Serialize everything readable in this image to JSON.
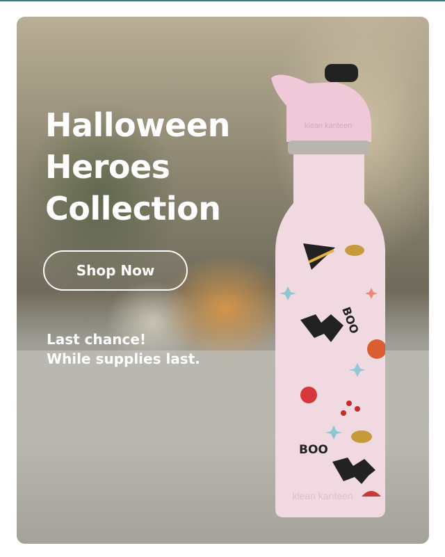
{
  "promo": {
    "headline": [
      "Halloween",
      "Heroes",
      "Collection"
    ],
    "cta_label": "Shop Now",
    "note": [
      "Last chance!",
      "While supplies last."
    ]
  },
  "product": {
    "brand_mark": "klean kanteen",
    "print_words": [
      "BOO",
      "BOO"
    ]
  },
  "colors": {
    "bottle_pink": "#f1d9e1",
    "cap_pink": "#efc9d8",
    "text": "#ffffff",
    "top_rule": "#2f7f82"
  }
}
